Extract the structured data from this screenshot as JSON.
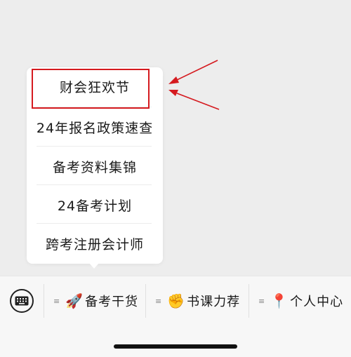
{
  "popup_menu": {
    "items": [
      {
        "label": "财会狂欢节"
      },
      {
        "label": "24年报名政策速查"
      },
      {
        "label": "备考资料集锦"
      },
      {
        "label": "24备考计划"
      },
      {
        "label": "跨考注册会计师"
      }
    ]
  },
  "bottom_menu": {
    "keyboard_icon": "keyboard-icon",
    "tabs": [
      {
        "icon": "rocket-icon",
        "emoji": "🚀",
        "label": "备考干货"
      },
      {
        "icon": "raised-fist-icon",
        "emoji": "✊",
        "label": "书课力荐"
      },
      {
        "icon": "round-pushpin-icon",
        "emoji": "📍",
        "label": "个人中心"
      }
    ]
  },
  "colors": {
    "annotation_red": "#d51a1f",
    "background": "#ededed",
    "popup_bg": "#ffffff"
  }
}
